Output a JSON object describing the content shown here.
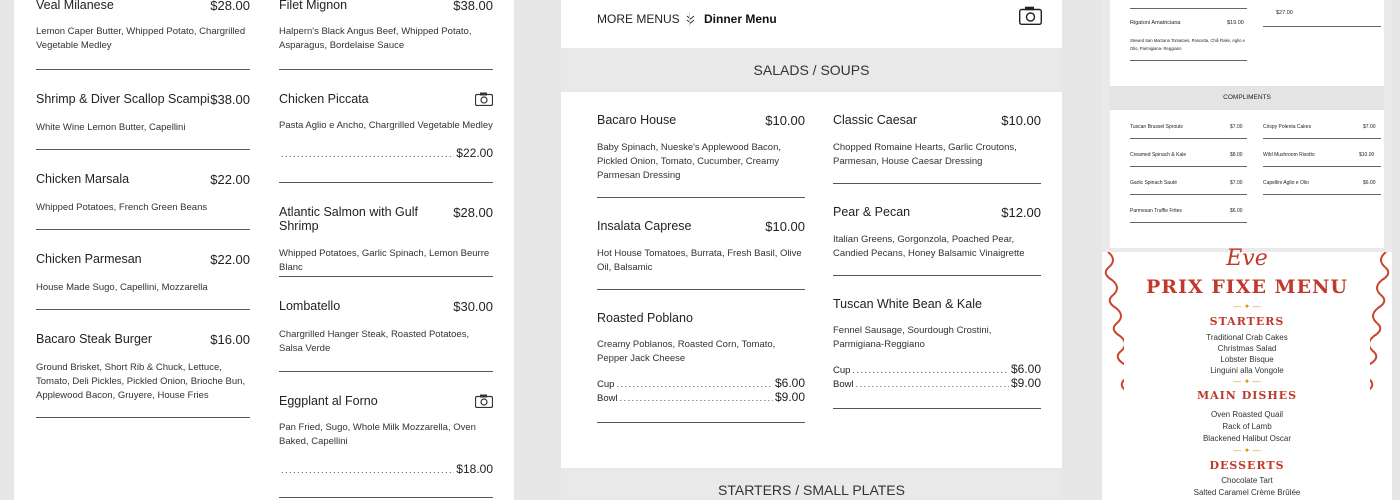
{
  "panel1": {
    "col1": [
      {
        "name": "Veal Milanese",
        "price": "$28.00",
        "desc": "Lemon Caper Butter, Whipped Potato, Chargrilled Vegetable Medley"
      },
      {
        "name": "Shrimp & Diver Scallop Scampi",
        "price": "$38.00",
        "desc": "White Wine Lemon Butter, Capellini"
      },
      {
        "name": "Chicken Marsala",
        "price": "$22.00",
        "desc": "Whipped Potatoes, French Green Beans"
      },
      {
        "name": "Chicken Parmesan",
        "price": "$22.00",
        "desc": "House Made Sugo, Capellini, Mozzarella"
      },
      {
        "name": "Bacaro Steak Burger",
        "price": "$16.00",
        "desc": "Ground Brisket, Short Rib & Chuck, Lettuce, Tomato, Deli Pickles, Pickled Onion, Brioche Bun, Applewood Bacon, Gruyere, House Fries"
      }
    ],
    "col2": [
      {
        "name": "Filet Mignon",
        "price": "$38.00",
        "desc": "Halpern's Black Angus Beef, Whipped Potato, Asparagus, Bordelaise Sauce"
      },
      {
        "name": "Chicken Piccata",
        "price": "$22.00",
        "desc": "Pasta Aglio e Ancho, Chargrilled Vegetable Medley"
      },
      {
        "name": "Atlantic Salmon with Gulf Shrimp",
        "price": "$28.00",
        "desc": "Whipped Potatoes, Garlic Spinach, Lemon Beurre Blanc"
      },
      {
        "name": "Lombatello",
        "price": "$30.00",
        "desc": "Chargrilled Hanger Steak, Roasted Potatoes, Salsa Verde"
      },
      {
        "name": "Eggplant al Forno",
        "price": "$18.00",
        "desc": "Pan Fried, Sugo, Whole Milk Mozzarella, Oven Baked, Capellini"
      }
    ]
  },
  "panel2": {
    "more_menus": "MORE MENUS",
    "dinner_menu": "Dinner Menu",
    "section1": "SALADS / SOUPS",
    "section2": "STARTERS / SMALL PLATES",
    "col1": [
      {
        "name": "Bacaro House",
        "price": "$10.00",
        "desc": "Baby Spinach, Nueske's Applewood Bacon, Pickled Onion, Tomato, Cucumber, Creamy Parmesan Dressing"
      },
      {
        "name": "Insalata Caprese",
        "price": "$10.00",
        "desc": "Hot House Tomatoes, Burrata, Fresh Basil, Olive Oil, Balsamic"
      },
      {
        "name": "Roasted Poblano",
        "desc": "Creamy Poblanos, Roasted Corn, Tomato, Pepper Jack Cheese",
        "cup_label": "Cup",
        "cup": "$6.00",
        "bowl_label": "Bowl",
        "bowl": "$9.00"
      }
    ],
    "col2": [
      {
        "name": "Classic Caesar",
        "price": "$10.00",
        "desc": "Chopped Romaine Hearts, Garlic Croutons, Parmesan, House Caesar Dressing"
      },
      {
        "name": "Pear & Pecan",
        "price": "$12.00",
        "desc": "Italian Greens, Gorgonzola, Poached Pear, Candied Pecans, Honey Balsamic Vinaigrette"
      },
      {
        "name": "Tuscan White Bean & Kale",
        "desc": "Fennel Sausage, Sourdough Crostini, Parmigiana-Reggiano",
        "cup_label": "Cup",
        "cup": "$6.00",
        "bowl_label": "Bowl",
        "bowl": "$9.00"
      }
    ]
  },
  "panel3": {
    "top_item": "Rigatoni Amatriciana",
    "top_price": "$19.00",
    "top_desc": "Stewed San Marzano Tomatoes, Pancetta, Chili Flake, Aglio e Olio, Parmigiana- Reggiano",
    "top_right_price": "$27.00",
    "compliments": "COMPLIMENTS",
    "left": [
      {
        "name": "Tuscan Brussel Sprouts",
        "price": "$7.00"
      },
      {
        "name": "Creamed Spinach & Kale",
        "price": "$8.00"
      },
      {
        "name": "Garlic Spinach Sauté",
        "price": "$7.00"
      },
      {
        "name": "Parmesan Truffle Frites",
        "price": "$6.00"
      }
    ],
    "right": [
      {
        "name": "Crispy Polenta Cakes",
        "price": "$7.00"
      },
      {
        "name": "Wild Mushroom Risotto",
        "price": "$10.00"
      },
      {
        "name": "Capellini Aglio e Olio",
        "price": "$6.00"
      }
    ],
    "prix": {
      "script": "Eve",
      "title": "PRIX FIXE MENU",
      "starters": "STARTERS",
      "starters_items": [
        "Traditional Crab Cakes",
        "Christmas Salad",
        "Lobster Bisque",
        "Linguini alla Vongole"
      ],
      "main": "MAIN DISHES",
      "main_items": [
        "Oven Roasted Quail",
        "Rack of Lamb",
        "Blackened Halibut Oscar"
      ],
      "desserts": "DESSERTS",
      "desserts_items": [
        "Chocolate Tart",
        "Salted Caramel Crème Brûlée"
      ]
    }
  }
}
